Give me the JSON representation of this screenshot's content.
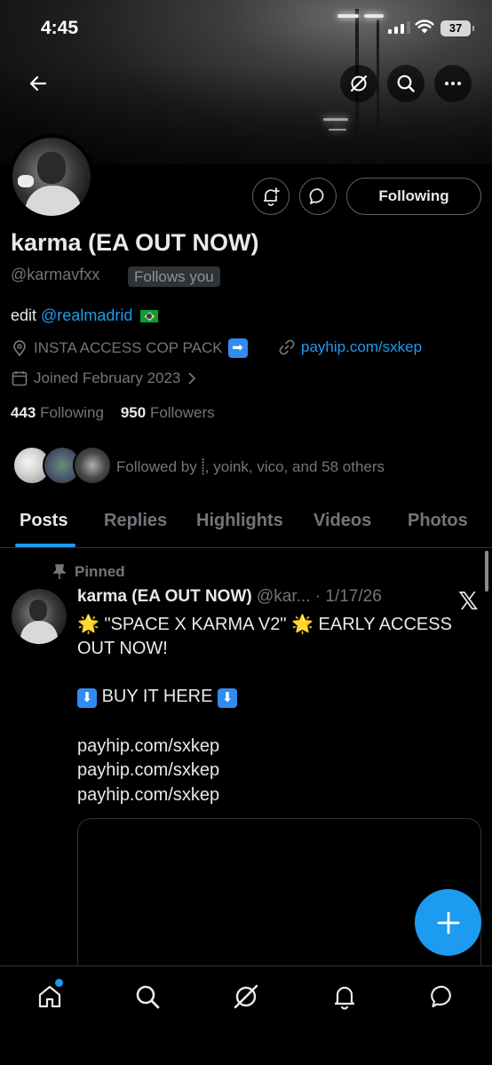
{
  "status": {
    "time": "4:45",
    "battery": "37"
  },
  "header": {
    "back": "back",
    "icons": [
      "grok-icon",
      "search-icon",
      "more-icon"
    ]
  },
  "profile": {
    "name": "karma (EA OUT NOW)",
    "handle": "@karmavfxx",
    "follows_you": "Follows you",
    "following_button": "Following",
    "bio_prefix": "edit ",
    "bio_mention": "@realmadrid",
    "location": "INSTA ACCESS COP PACK",
    "website": "payhip.com/sxkep",
    "joined": "Joined February 2023",
    "following_count": "443",
    "following_label": "Following",
    "followers_count": "950",
    "followers_label": "Followers",
    "followed_by": "Followed by ⸽, yoink, vico, and 58 others"
  },
  "tabs": [
    "Posts",
    "Replies",
    "Highlights",
    "Videos",
    "Photos"
  ],
  "post": {
    "pinned_label": "Pinned",
    "author_name": "karma (EA OUT NOW)",
    "author_handle": "@kar...",
    "date": "· 1/17/26",
    "line1": "\"SPACE X KARMA V2\"",
    "line1_suffix": "EARLY ACCESS",
    "line2": "OUT NOW!",
    "line3": "BUY IT HERE",
    "links": [
      "payhip.com/sxkep",
      "payhip.com/sxkep",
      "payhip.com/sxkep"
    ]
  },
  "colors": {
    "accent": "#1d9bf0",
    "muted": "#71767b",
    "border": "#2f3336"
  }
}
